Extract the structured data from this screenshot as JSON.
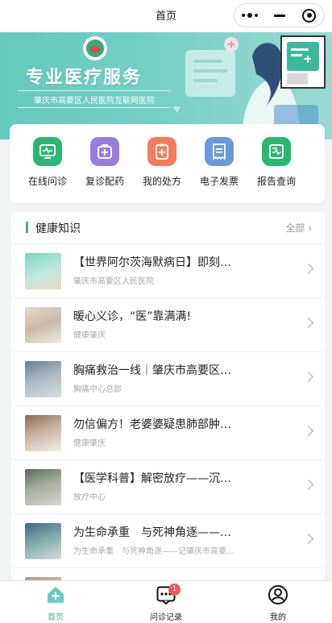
{
  "header": {
    "title": "首页"
  },
  "banner": {
    "title": "专业医疗服务",
    "subtitle": "肇庆市高要区人民医院互联网医院"
  },
  "quick_actions": [
    {
      "label": "在线问诊",
      "icon": "monitor-heart-icon",
      "color": "#2ab772"
    },
    {
      "label": "复诊配药",
      "icon": "medicine-box-icon",
      "color": "#9b7bde"
    },
    {
      "label": "我的处方",
      "icon": "clipboard-plus-icon",
      "color": "#f47c5c"
    },
    {
      "label": "电子发票",
      "icon": "invoice-icon",
      "color": "#6a98dc"
    },
    {
      "label": "报告查询",
      "icon": "report-chart-icon",
      "color": "#2ab772"
    }
  ],
  "news": {
    "title": "健康知识",
    "more_label": "全部",
    "items": [
      {
        "title": "【世界阿尔茨海默病日】即刻…",
        "source": "肇庆市高要区人民医院"
      },
      {
        "title": "暖心义诊，“医”靠满满!",
        "source": "健康肇庆"
      },
      {
        "title": "胸痛救治一线｜肇庆市高要区…",
        "source": "胸痛中心总部"
      },
      {
        "title": "勿信偏方！老婆婆疑患肺部肿…",
        "source": "健康肇庆"
      },
      {
        "title": "【医学科普】解密放疗——沉…",
        "source": "放疗中心"
      },
      {
        "title": "为生命承重　与死神角逐——…",
        "source": "为生命承重　与死神角逐——记肇庆市高要…"
      },
      {
        "title": "",
        "source": ""
      }
    ]
  },
  "tabbar": {
    "items": [
      {
        "label": "首页",
        "icon": "home-plus-icon",
        "active": true
      },
      {
        "label": "问诊记录",
        "icon": "chat-dots-icon",
        "badge": "1"
      },
      {
        "label": "我的",
        "icon": "user-circle-icon"
      }
    ]
  },
  "colors": {
    "brand": "#3fb28f",
    "banner": "#6ccbbf",
    "badge": "#f0575b"
  }
}
